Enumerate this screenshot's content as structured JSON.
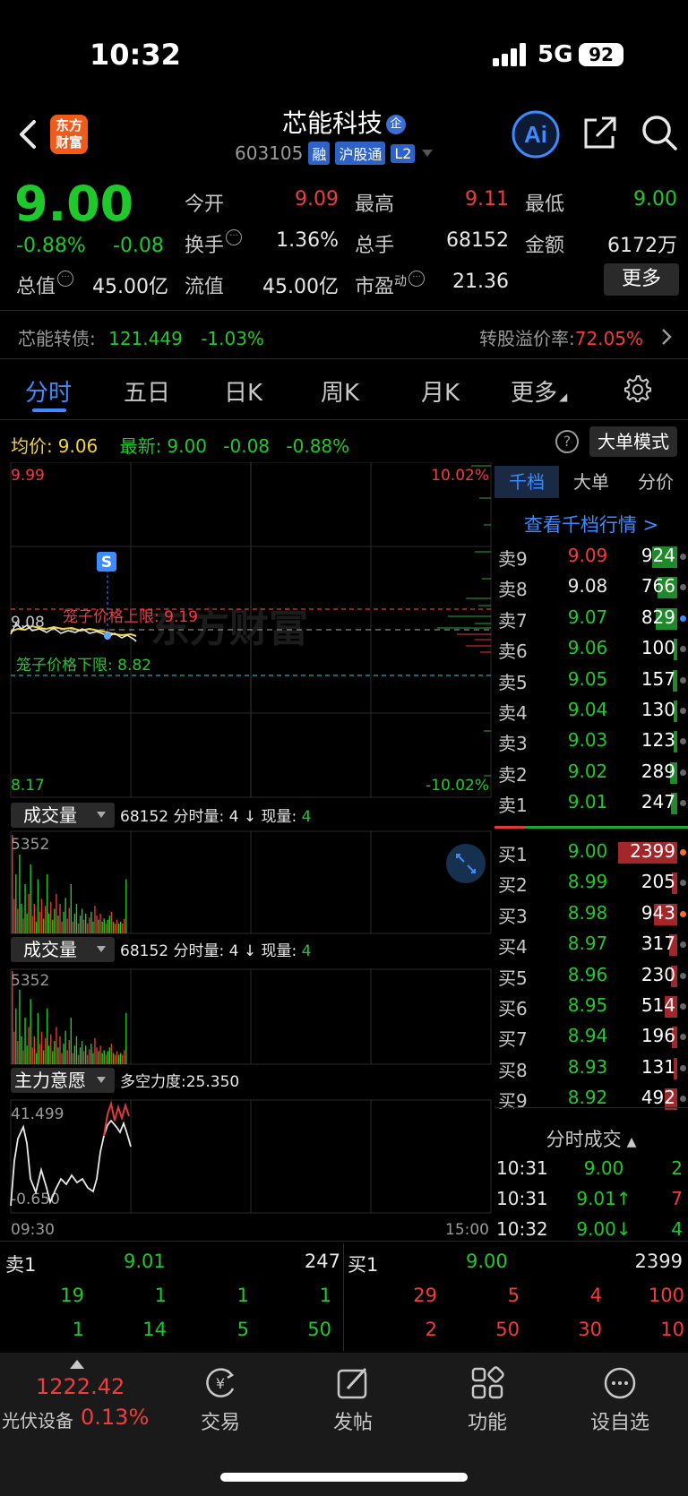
{
  "status": {
    "time": "10:32",
    "network": "5G",
    "battery": "92"
  },
  "header": {
    "logo_line1": "东方",
    "logo_line2": "财富",
    "stock_name": "芯能科技",
    "qi_badge": "企",
    "stock_code": "603105",
    "tags": [
      "融",
      "沪股通",
      "L2"
    ]
  },
  "quote": {
    "price": "9.00",
    "pct": "-0.88%",
    "change": "-0.08",
    "open_label": "今开",
    "open": "9.09",
    "high_label": "最高",
    "high": "9.11",
    "low_label": "最低",
    "low": "9.00",
    "turnover_label": "换手",
    "turnover": "1.36%",
    "volume_label": "总手",
    "volume": "68152",
    "amount_label": "金额",
    "amount": "6172万",
    "mktcap_label": "总值",
    "mktcap": "45.00亿",
    "float_label": "流值",
    "float_cap": "45.00亿",
    "pe_label": "市盈",
    "pe_sup": "动",
    "pe": "21.36",
    "more": "更多"
  },
  "bond": {
    "label": "芯能转债:",
    "price": "121.449",
    "pct": "-1.03%",
    "premium_label": "转股溢价率:",
    "premium": "72.05%"
  },
  "tabs": [
    "分时",
    "五日",
    "日K",
    "周K",
    "月K",
    "更多"
  ],
  "avg_row": {
    "avg_label": "均价:",
    "avg": "9.06",
    "latest_label": "最新:",
    "latest": "9.00",
    "chg": "-0.08",
    "pct": "-0.88%",
    "help": "?",
    "big_order": "大单模式"
  },
  "chart": {
    "price_top": "9.99",
    "price_bottom": "8.17",
    "pct_top": "10.02%",
    "pct_bottom": "-10.02%",
    "prev_close": "9.08",
    "cage_upper": "笼子价格上限: 9.19",
    "cage_lower": "笼子价格下限: 8.82",
    "s_marker": "S",
    "watermark": "东方财富",
    "vol_label": "成交量",
    "vol_info_total": "68152",
    "vol_info_mid": "分时量: 4 ↓ 现量:",
    "vol_info_now": "4",
    "vol_max": "5352",
    "force_label": "主力意愿",
    "force_info": "多空力度:25.350",
    "force_top": "41.499",
    "force_bottom": "-0.650",
    "time_start": "09:30",
    "time_end": "15:00"
  },
  "orderbook": {
    "tabs": [
      "千档",
      "大单",
      "分价"
    ],
    "view_all": "查看千档行情 >",
    "asks": [
      {
        "label": "卖9",
        "price": "9.09",
        "vol": "924",
        "bar": 0.28,
        "dot": "#666"
      },
      {
        "label": "卖8",
        "price": "9.08",
        "vol": "766",
        "bar": 0.22,
        "dot": "#666"
      },
      {
        "label": "卖7",
        "price": "9.07",
        "vol": "829",
        "bar": 0.24,
        "dot": "#3d8bff"
      },
      {
        "label": "卖6",
        "price": "9.06",
        "vol": "100",
        "bar": 0.04,
        "dot": "#666"
      },
      {
        "label": "卖5",
        "price": "9.05",
        "vol": "157",
        "bar": 0.05,
        "dot": "#666"
      },
      {
        "label": "卖4",
        "price": "9.04",
        "vol": "130",
        "bar": 0.04,
        "dot": "#666"
      },
      {
        "label": "卖3",
        "price": "9.03",
        "vol": "123",
        "bar": 0.04,
        "dot": "#666"
      },
      {
        "label": "卖2",
        "price": "9.02",
        "vol": "289",
        "bar": 0.08,
        "dot": "#666"
      },
      {
        "label": "卖1",
        "price": "9.01",
        "vol": "247",
        "bar": 0.07,
        "dot": "#666"
      }
    ],
    "bids": [
      {
        "label": "买1",
        "price": "9.00",
        "vol": "2399",
        "bar": 0.66,
        "dot": "#ff6a2a"
      },
      {
        "label": "买2",
        "price": "8.99",
        "vol": "205",
        "bar": 0.06,
        "dot": "#666"
      },
      {
        "label": "买3",
        "price": "8.98",
        "vol": "943",
        "bar": 0.26,
        "dot": "#ff6a2a"
      },
      {
        "label": "买4",
        "price": "8.97",
        "vol": "317",
        "bar": 0.09,
        "dot": "#666"
      },
      {
        "label": "买5",
        "price": "8.96",
        "vol": "230",
        "bar": 0.07,
        "dot": "#666"
      },
      {
        "label": "买6",
        "price": "8.95",
        "vol": "514",
        "bar": 0.14,
        "dot": "#666"
      },
      {
        "label": "买7",
        "price": "8.94",
        "vol": "196",
        "bar": 0.06,
        "dot": "#666"
      },
      {
        "label": "买8",
        "price": "8.93",
        "vol": "131",
        "bar": 0.04,
        "dot": "#666"
      },
      {
        "label": "买9",
        "price": "8.92",
        "vol": "492",
        "bar": 0.14,
        "dot": "#666"
      }
    ],
    "ticks_header": "分时成交",
    "ticks": [
      {
        "time": "10:31",
        "price": "9.00",
        "vol": "2",
        "arrow": ""
      },
      {
        "time": "10:31",
        "price": "9.01↑",
        "vol": "7",
        "arrow": "up"
      },
      {
        "time": "10:32",
        "price": "9.00↓",
        "vol": "4",
        "arrow": "down"
      }
    ]
  },
  "summary": {
    "ask_label": "卖1",
    "ask_price": "9.01",
    "ask_vol": "247",
    "bid_label": "买1",
    "bid_price": "9.00",
    "bid_vol": "2399",
    "ask_queue_row1": [
      "19",
      "1",
      "1",
      "1"
    ],
    "ask_queue_row2": [
      "1",
      "14",
      "5",
      "50"
    ],
    "bid_queue_row1": [
      "29",
      "5",
      "4",
      "100"
    ],
    "bid_queue_row2": [
      "2",
      "50",
      "30",
      "10"
    ]
  },
  "bottom_nav": {
    "index_value": "1222.42",
    "index_name": "光伏设备",
    "index_pct": "0.13%",
    "items": [
      "交易",
      "发帖",
      "功能",
      "设自选"
    ]
  }
}
